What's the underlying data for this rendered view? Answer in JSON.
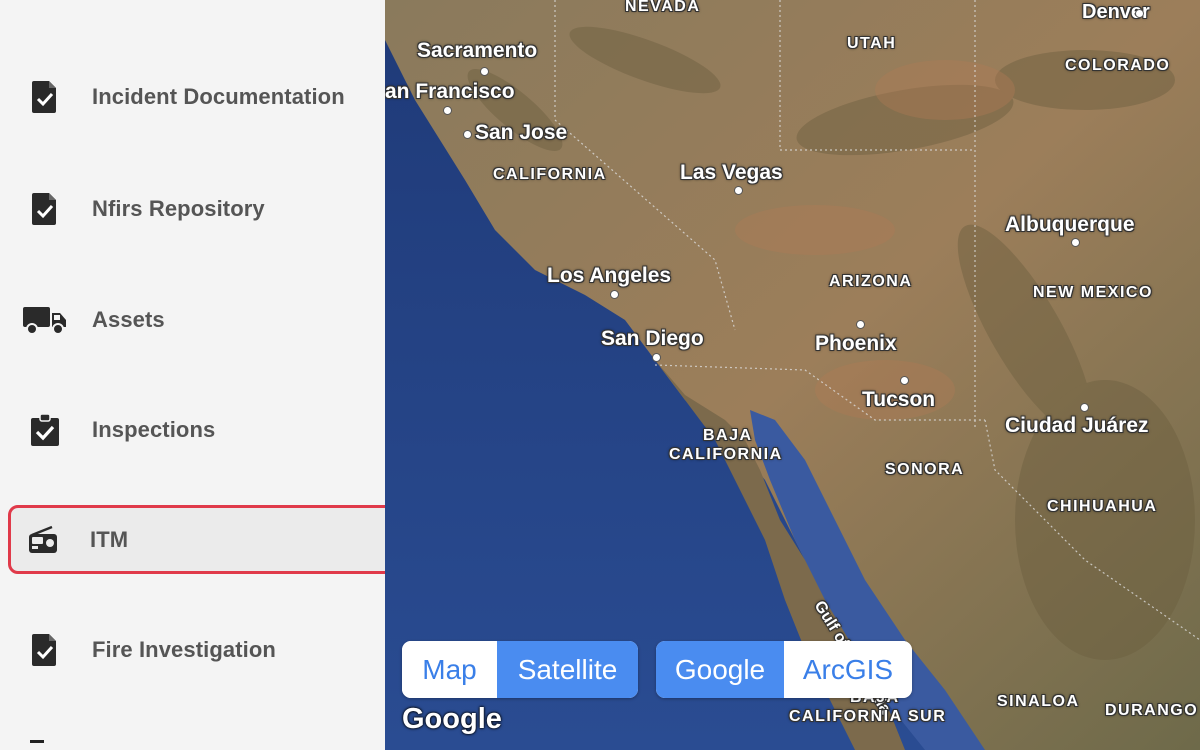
{
  "sidebar": {
    "items": [
      {
        "label": "Incident Documentation",
        "icon": "file-check-icon"
      },
      {
        "label": "Nfirs Repository",
        "icon": "file-check-icon"
      },
      {
        "label": "Assets",
        "icon": "truck-icon"
      },
      {
        "label": "Inspections",
        "icon": "clipboard-check-icon"
      },
      {
        "label": "ITM",
        "icon": "radio-icon",
        "selected": true
      },
      {
        "label": "Fire Investigation",
        "icon": "file-check-icon"
      }
    ],
    "highlight_color": "#e03a4a"
  },
  "map": {
    "labels": {
      "nevada": "NEVADA",
      "denver": "Denver",
      "utah": "UTAH",
      "colorado": "COLORADO",
      "sacramento": "Sacramento",
      "san_francisco": "an Francisco",
      "san_jose": "San Jose",
      "california": "CALIFORNIA",
      "las_vegas": "Las Vegas",
      "albuquerque": "Albuquerque",
      "los_angeles": "Los Angeles",
      "arizona": "ARIZONA",
      "new_mexico": "NEW MEXICO",
      "san_diego": "San Diego",
      "phoenix": "Phoenix",
      "tucson": "Tucson",
      "ciudad_juarez": "Ciudad Juárez",
      "baja_california_1": "BAJA",
      "baja_california_2": "CALIFORNIA",
      "sonora": "SONORA",
      "chihuahua": "CHIHUAHUA",
      "gulf": "Gulf of California",
      "baja_sur_1": "BAJA",
      "baja_sur_2": "CALIFORNIA SUR",
      "sinaloa": "SINALOA",
      "durango": "DURANGO"
    },
    "map_type_toggle": {
      "map": "Map",
      "satellite": "Satellite",
      "active": "Satellite"
    },
    "provider_toggle": {
      "google": "Google",
      "arcgis": "ArcGIS",
      "active": "Google"
    },
    "attribution": "Google",
    "active_color": "#4a8cf0"
  }
}
